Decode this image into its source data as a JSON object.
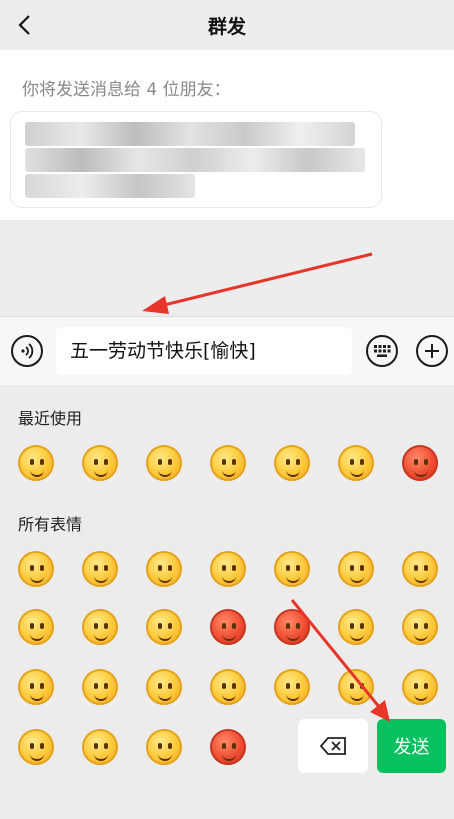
{
  "header": {
    "title": "群发",
    "back_icon": "chevron-left-icon"
  },
  "info": {
    "label": "你将发送消息给 4 位朋友："
  },
  "input": {
    "value": "五一劳动节快乐[愉快]"
  },
  "icons": {
    "voice": "voice-icon",
    "keyboard": "keyboard-icon",
    "plus": "plus-icon"
  },
  "emoji_panel": {
    "recent_title": "最近使用",
    "all_title": "所有表情"
  },
  "buttons": {
    "send": "发送",
    "delete": "backspace-icon"
  },
  "colors": {
    "send": "#07c160",
    "arrow": "#e8352a"
  }
}
